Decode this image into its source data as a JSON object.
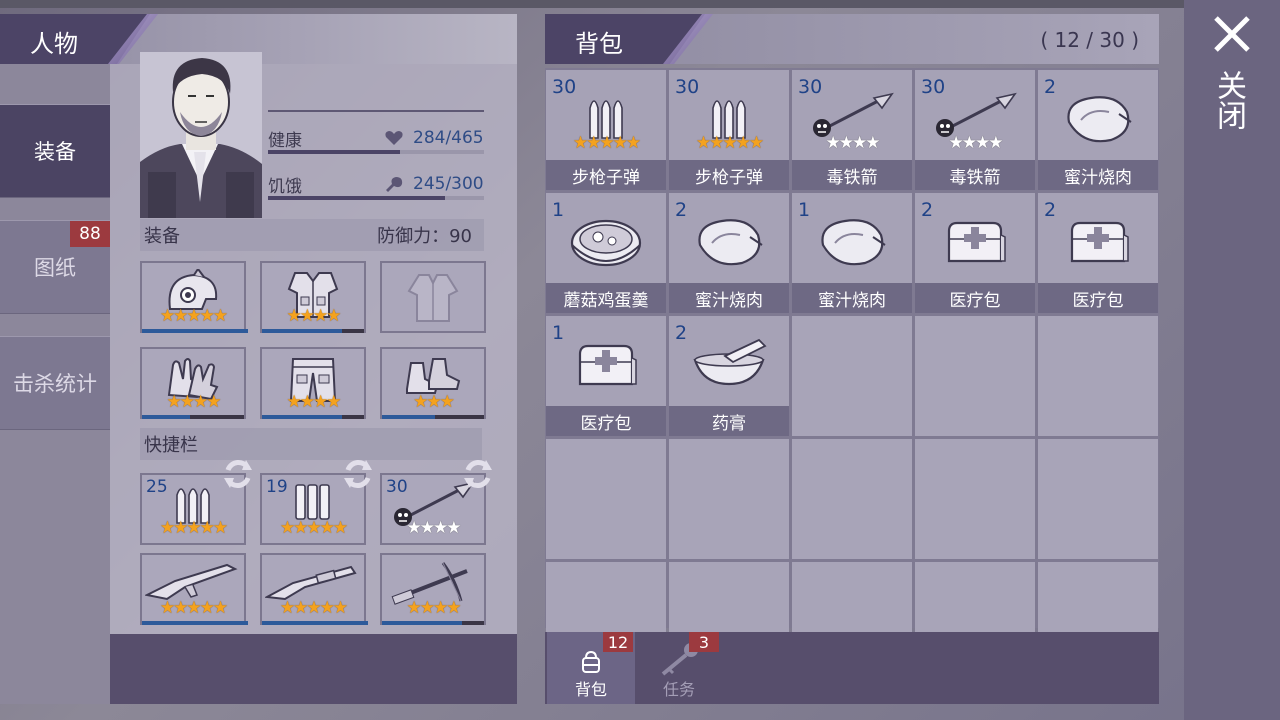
{
  "character": {
    "title": "人物",
    "tabs": [
      {
        "label": "装备",
        "active": true,
        "badge": ""
      },
      {
        "label": "图纸",
        "active": false,
        "badge": "88"
      },
      {
        "label": "击杀统计",
        "active": false,
        "badge": ""
      }
    ],
    "stats": {
      "health_label": "健康",
      "health_value": "284/465",
      "health_fraction": 0.61,
      "hunger_label": "饥饿",
      "hunger_value": "245/300",
      "hunger_fraction": 0.82
    },
    "equipment_title": "装备",
    "defense_text": "防御力：90",
    "equipment_slots": [
      {
        "icon": "helmet-icon",
        "stars": 5,
        "gold": 5,
        "durability": 1.0
      },
      {
        "icon": "armor-vest-icon",
        "stars": 4,
        "gold": 4,
        "durability": 0.75
      },
      {
        "icon": "empty-jacket-icon",
        "stars": 0,
        "gold": 0,
        "durability": 0
      },
      {
        "icon": "gloves-icon",
        "stars": 4,
        "gold": 4,
        "durability": 0.45
      },
      {
        "icon": "pants-icon",
        "stars": 4,
        "gold": 4,
        "durability": 0.75
      },
      {
        "icon": "boots-icon",
        "stars": 3,
        "gold": 3,
        "durability": 0.5
      }
    ],
    "quickbar_title": "快捷栏",
    "quickbar_slots": [
      {
        "count": "25",
        "icon": "bullets-icon",
        "stars": 5,
        "gold": 5,
        "durability": 0
      },
      {
        "count": "19",
        "icon": "shells-icon",
        "stars": 5,
        "gold": 5,
        "durability": 0
      },
      {
        "count": "30",
        "icon": "poison-arrow-icon",
        "stars": 4,
        "gold": 0,
        "durability": 0
      },
      {
        "count": "",
        "icon": "rifle-icon",
        "stars": 5,
        "gold": 5,
        "durability": 1.0
      },
      {
        "count": "",
        "icon": "shotgun-icon",
        "stars": 5,
        "gold": 5,
        "durability": 1.0
      },
      {
        "count": "",
        "icon": "crossbow-icon",
        "stars": 4,
        "gold": 4,
        "durability": 0.75
      }
    ]
  },
  "backpack": {
    "title": "背包",
    "capacity": "( 12 / 30 )",
    "items": [
      {
        "count": "30",
        "name": "步枪子弹",
        "icon": "rifle-bullets-icon",
        "stars": 5,
        "gold": 5,
        "poison": false
      },
      {
        "count": "30",
        "name": "步枪子弹",
        "icon": "rifle-bullets-icon",
        "stars": 5,
        "gold": 5,
        "poison": false
      },
      {
        "count": "30",
        "name": "毒铁箭",
        "icon": "poison-arrow-icon",
        "stars": 4,
        "gold": 0,
        "poison": true
      },
      {
        "count": "30",
        "name": "毒铁箭",
        "icon": "poison-arrow-icon",
        "stars": 4,
        "gold": 0,
        "poison": true
      },
      {
        "count": "2",
        "name": "蜜汁烧肉",
        "icon": "roast-meat-icon",
        "stars": 0,
        "gold": 0,
        "poison": false
      },
      {
        "count": "1",
        "name": "蘑菇鸡蛋羹",
        "icon": "mushroom-soup-icon",
        "stars": 0,
        "gold": 0,
        "poison": false
      },
      {
        "count": "2",
        "name": "蜜汁烧肉",
        "icon": "roast-meat-icon",
        "stars": 0,
        "gold": 0,
        "poison": false
      },
      {
        "count": "1",
        "name": "蜜汁烧肉",
        "icon": "roast-meat-icon",
        "stars": 0,
        "gold": 0,
        "poison": false
      },
      {
        "count": "2",
        "name": "医疗包",
        "icon": "medkit-icon",
        "stars": 0,
        "gold": 0,
        "poison": false
      },
      {
        "count": "2",
        "name": "医疗包",
        "icon": "medkit-icon",
        "stars": 0,
        "gold": 0,
        "poison": false
      },
      {
        "count": "1",
        "name": "医疗包",
        "icon": "medkit-icon",
        "stars": 0,
        "gold": 0,
        "poison": false
      },
      {
        "count": "2",
        "name": "药膏",
        "icon": "ointment-icon",
        "stars": 0,
        "gold": 0,
        "poison": false
      }
    ],
    "tabs": [
      {
        "label": "背包",
        "badge": "12",
        "icon": "backpack-icon",
        "active": true
      },
      {
        "label": "任务",
        "badge": "3",
        "icon": "key-icon",
        "active": false
      }
    ]
  },
  "close": {
    "label": "关闭",
    "icon": "close-icon"
  },
  "colors": {
    "star_gold": "#f4a21e",
    "badge_red": "#9c3a3f",
    "count_blue": "#1f4287",
    "durability_blue": "#2d5a9a"
  }
}
